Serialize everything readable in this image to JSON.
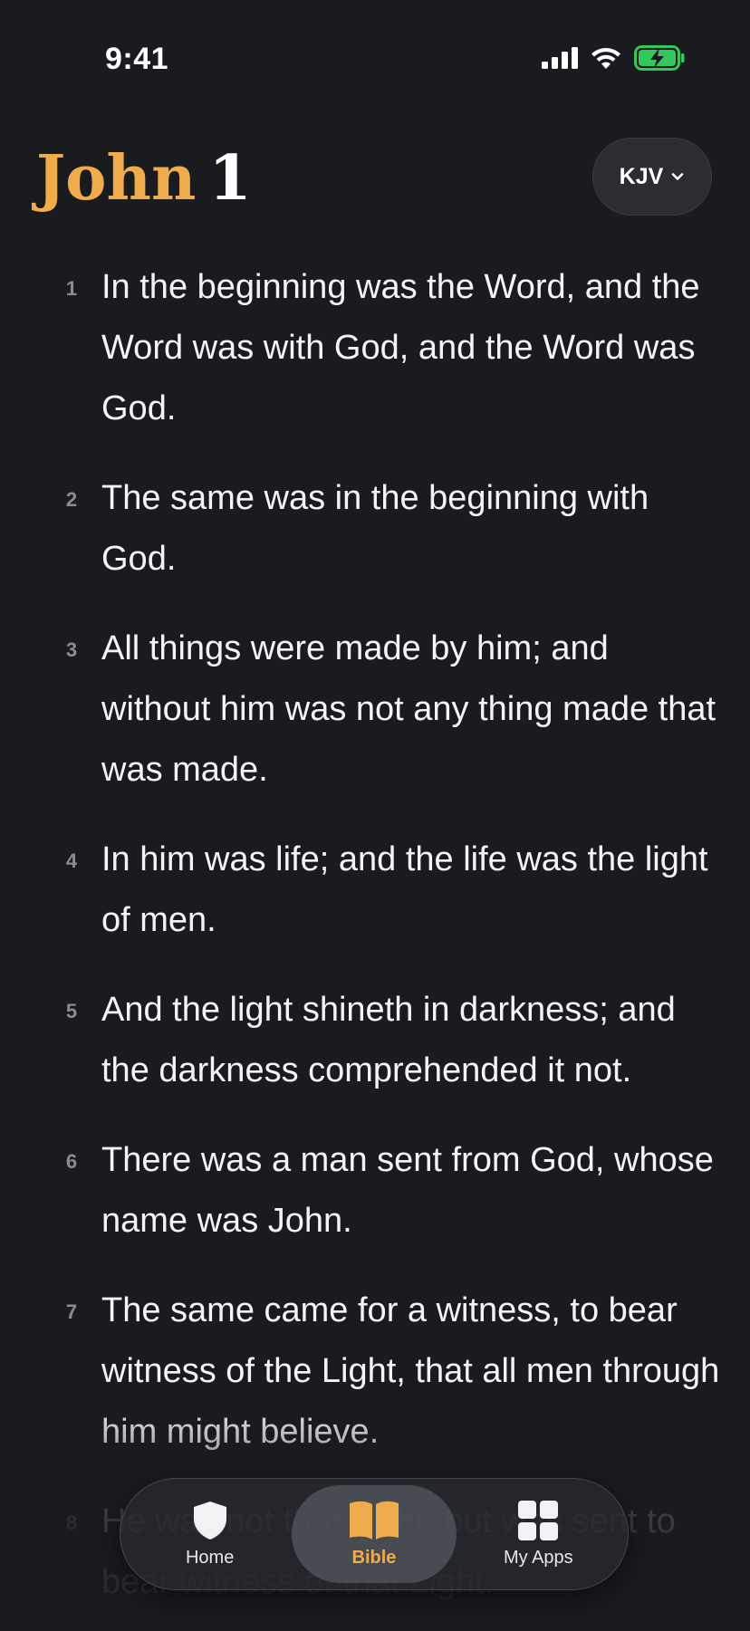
{
  "status_bar": {
    "time": "9:41"
  },
  "header": {
    "book": "John",
    "chapter": "1",
    "version_label": "KJV"
  },
  "verses": [
    {
      "num": "1",
      "text": "In the beginning was the Word, and the Word was with God, and the Word was God."
    },
    {
      "num": "2",
      "text": "The same was in the beginning with God."
    },
    {
      "num": "3",
      "text": "All things were made by him; and without him was not any thing made that was made."
    },
    {
      "num": "4",
      "text": "In him was life; and the life was the light of men."
    },
    {
      "num": "5",
      "text": "And the light shineth in darkness; and the darkness comprehended it not."
    },
    {
      "num": "6",
      "text": "There was a man sent from God, whose name was John."
    },
    {
      "num": "7",
      "text": "The same came for a witness, to bear witness of the Light, that all men through him might believe."
    },
    {
      "num": "8",
      "text": "He was not that Light, but was sent to bear witness of that Light."
    }
  ],
  "tab_bar": {
    "tabs": [
      {
        "label": "Home",
        "icon": "shield-icon"
      },
      {
        "label": "Bible",
        "icon": "open-book-icon",
        "active": true
      },
      {
        "label": "My Apps",
        "icon": "grid-icon"
      }
    ]
  },
  "colors": {
    "accent": "#efac4d",
    "background": "#1a1b1f",
    "battery_green": "#34c759"
  }
}
